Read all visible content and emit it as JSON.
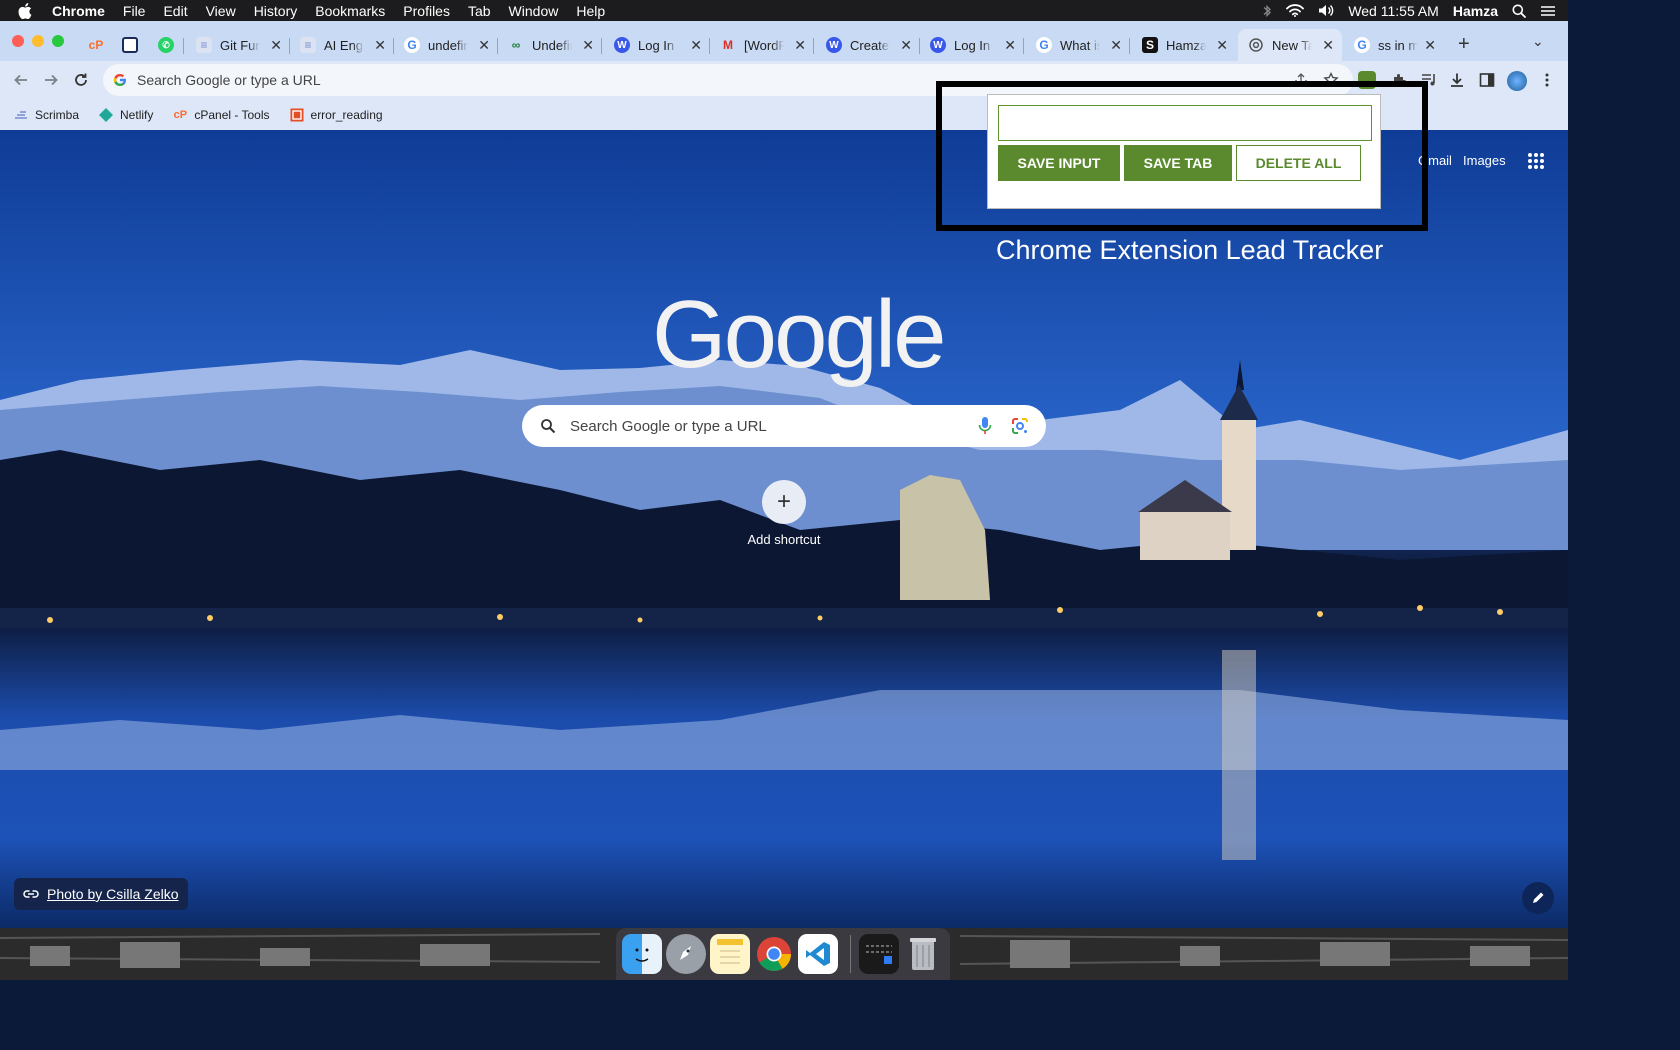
{
  "menubar": {
    "app_name": "Chrome",
    "menus": [
      "File",
      "Edit",
      "View",
      "History",
      "Bookmarks",
      "Profiles",
      "Tab",
      "Window",
      "Help"
    ],
    "clock": "Wed 11:55 AM",
    "user": "Hamza"
  },
  "tabs": [
    {
      "title": "",
      "icon": "cpanel-icon"
    },
    {
      "title": "",
      "icon": "photo-icon"
    },
    {
      "title": "",
      "icon": "whatsapp-icon"
    },
    {
      "title": "Git Func",
      "icon": "scrimba-icon"
    },
    {
      "title": "AI Engin",
      "icon": "scrimba-icon"
    },
    {
      "title": "undefin",
      "icon": "google-icon"
    },
    {
      "title": "Undefin",
      "icon": "link-icon"
    },
    {
      "title": "Log In –",
      "icon": "wordpress-icon"
    },
    {
      "title": "[WordPr",
      "icon": "gmail-icon"
    },
    {
      "title": "Create a",
      "icon": "wordpress-icon"
    },
    {
      "title": "Log In ‹",
      "icon": "wordpress-icon"
    },
    {
      "title": "What is",
      "icon": "google-icon"
    },
    {
      "title": "Hamza f",
      "icon": "s-icon"
    },
    {
      "title": "New Tab",
      "icon": "chrome-icon",
      "active": true
    },
    {
      "title": "ss in ma",
      "icon": "google-icon"
    }
  ],
  "omnibox": {
    "placeholder": "Search Google or type a URL"
  },
  "bookmarks": [
    "Scrimba",
    "Netlify",
    "cPanel - Tools",
    "error_reading"
  ],
  "newtab": {
    "logo": "Google",
    "search_placeholder": "Search Google or type a URL",
    "add_shortcut": "Add shortcut",
    "gmail": "Gmail",
    "images": "Images",
    "photo_credit": "Photo by Csilla Zelko"
  },
  "extension": {
    "input_value": "",
    "save_input": "SAVE INPUT",
    "save_tab": "SAVE TAB",
    "delete_all": "DELETE ALL",
    "caption": "Chrome Extension Lead Tracker",
    "accent": "#5a8a2d"
  },
  "dock": [
    "finder-icon",
    "launchpad-icon",
    "notes-icon",
    "chrome-icon",
    "vscode-icon",
    "screenshot-icon",
    "trash-icon"
  ]
}
